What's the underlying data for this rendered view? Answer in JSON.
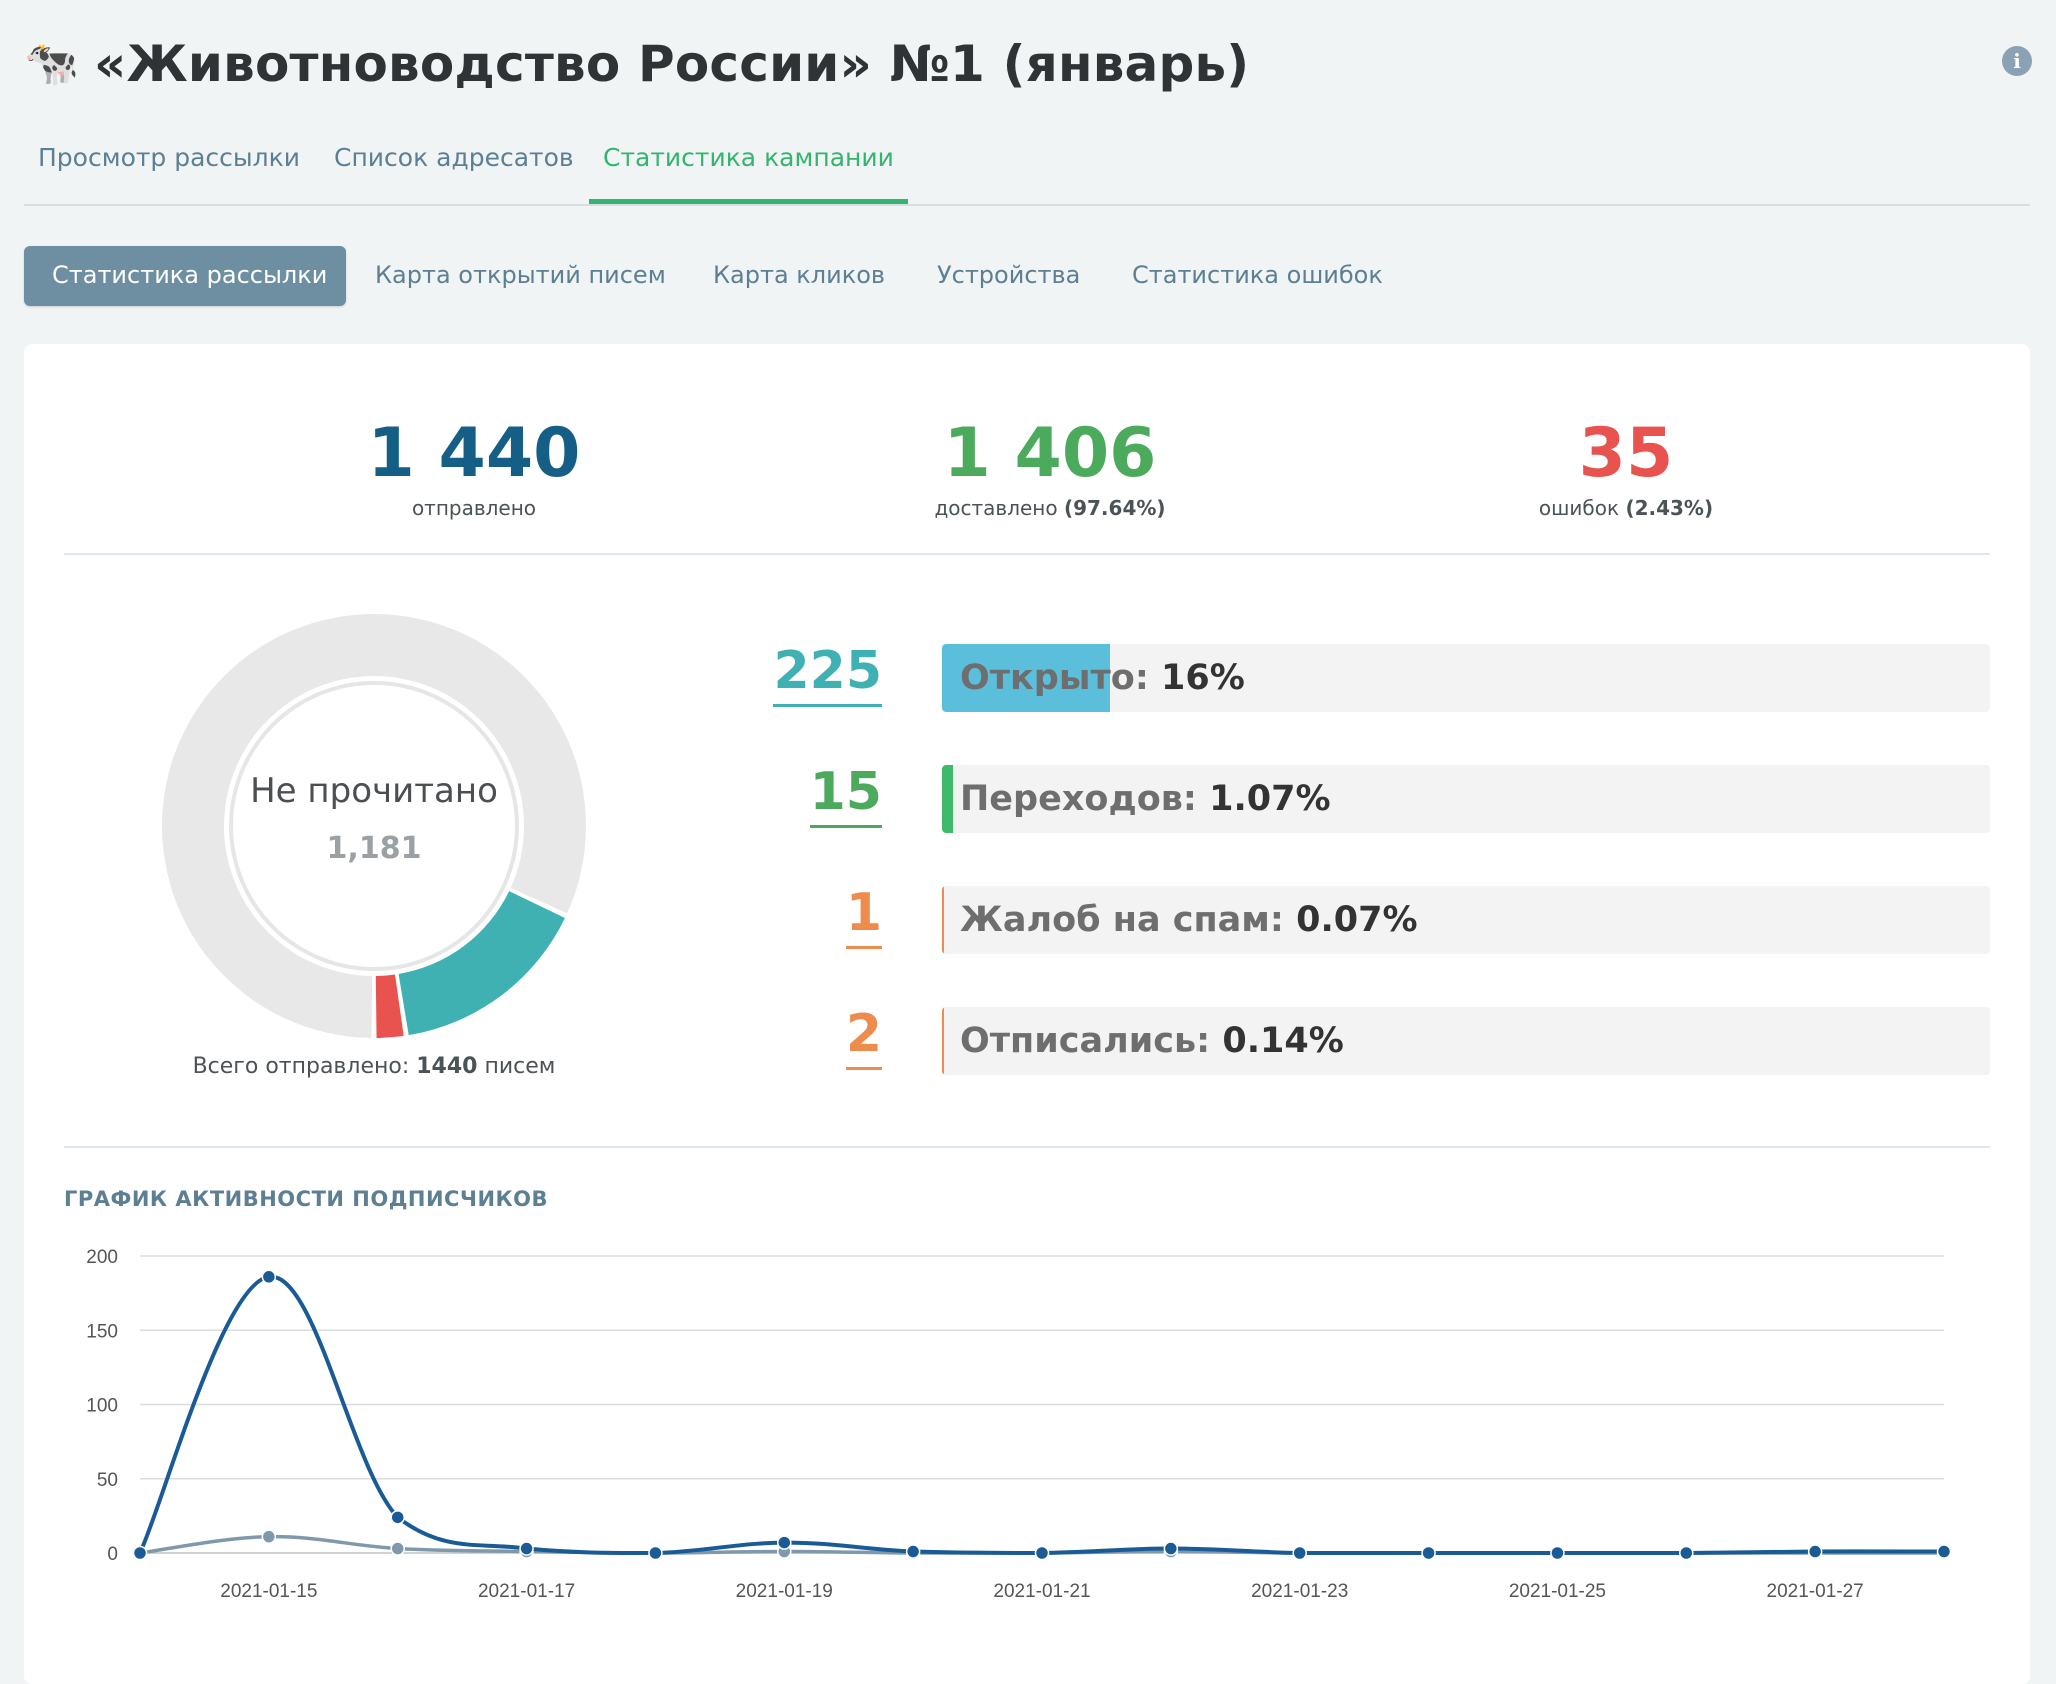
{
  "header": {
    "icon": "cow-emoji",
    "icon_glyph": "🐄",
    "title": "«Животноводство России» №1 (январь)",
    "info_glyph": "i"
  },
  "tabs": [
    {
      "label": "Просмотр рассылки",
      "active": false
    },
    {
      "label": "Список адресатов",
      "active": false
    },
    {
      "label": "Статистика кампании",
      "active": true
    }
  ],
  "subtabs": [
    {
      "label": "Статистика рассылки",
      "active": true
    },
    {
      "label": "Карта открытий писем",
      "active": false
    },
    {
      "label": "Карта кликов",
      "active": false
    },
    {
      "label": "Устройства",
      "active": false
    },
    {
      "label": "Статистика ошибок",
      "active": false
    }
  ],
  "kpis": {
    "sent": {
      "value": "1 440",
      "label": "отправлено",
      "color": "#155f87"
    },
    "delivered": {
      "value": "1 406",
      "label": "доставлено",
      "pct": "(97.64%)",
      "color": "#4caa5c"
    },
    "errors": {
      "value": "35",
      "label": "ошибок",
      "pct": "(2.43%)",
      "color": "#e8534f"
    }
  },
  "donut": {
    "center_label": "Не прочитано",
    "center_value": "1,181",
    "segments": [
      {
        "name": "Не прочитано",
        "value": 1181,
        "color": "#e8e8e8"
      },
      {
        "name": "Открыто",
        "value": 225,
        "color": "#3fb1b3"
      },
      {
        "name": "Ошибки",
        "value": 35,
        "color": "#e8534f"
      }
    ],
    "total_prefix": "Всего отправлено:",
    "total_value": "1440",
    "total_suffix": "писем"
  },
  "stats": [
    {
      "num": "225",
      "label": "Открыто",
      "pct": "16%",
      "fraction": 0.16,
      "num_color": "#3fb1b3",
      "bar_color": "#5bbfdc"
    },
    {
      "num": "15",
      "label": "Переходов",
      "pct": "1.07%",
      "fraction": 0.0107,
      "num_color": "#4caa5c",
      "bar_color": "#3fba6b"
    },
    {
      "num": "1",
      "label": "Жалоб на спам",
      "pct": "0.07%",
      "fraction": 0.0007,
      "num_color": "#ee8c4d",
      "bar_color": "#ee8c4d"
    },
    {
      "num": "2",
      "label": "Отписались",
      "pct": "0.14%",
      "fraction": 0.0014,
      "num_color": "#ee8c4d",
      "bar_color": "#ee8c4d"
    }
  ],
  "chart_title": "ГРАФИК АКТИВНОСТИ ПОДПИСЧИКОВ",
  "chart_data": {
    "type": "line",
    "x": [
      "2021-01-14",
      "2021-01-15",
      "2021-01-16",
      "2021-01-17",
      "2021-01-18",
      "2021-01-19",
      "2021-01-20",
      "2021-01-21",
      "2021-01-22",
      "2021-01-23",
      "2021-01-24",
      "2021-01-25",
      "2021-01-26",
      "2021-01-27",
      "2021-01-28"
    ],
    "x_tick_labels": [
      "2021-01-15",
      "2021-01-17",
      "2021-01-19",
      "2021-01-21",
      "2021-01-23",
      "2021-01-25",
      "2021-01-27"
    ],
    "ylim": [
      0,
      200
    ],
    "y_ticks": [
      "0",
      "50",
      "100",
      "150",
      "200"
    ],
    "grid": true,
    "series": [
      {
        "values": [
          0,
          186,
          24,
          3,
          0,
          7,
          1,
          0,
          3,
          0,
          0,
          0,
          0,
          1,
          1
        ],
        "color": "#1a5b96"
      },
      {
        "values": [
          0,
          11,
          3,
          1,
          0,
          1,
          0,
          0,
          1,
          0,
          0,
          0,
          0,
          0,
          0
        ],
        "color": "#7f98ab"
      }
    ]
  }
}
